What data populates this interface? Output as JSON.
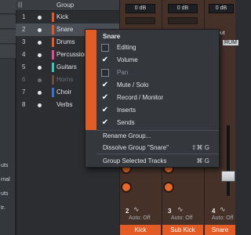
{
  "group_panel": {
    "header_label": "Group",
    "header_icon": "group-columns-icon"
  },
  "groups": [
    {
      "num": "1",
      "name": "Kick",
      "color": "#e0582a",
      "dim": false,
      "selected": false
    },
    {
      "num": "2",
      "name": "Snare",
      "color": "#e0582a",
      "dim": false,
      "selected": true
    },
    {
      "num": "3",
      "name": "Drums",
      "color": "#e0582a",
      "dim": false,
      "selected": false
    },
    {
      "num": "4",
      "name": "Percussion",
      "color": "#e24a93",
      "dim": false,
      "selected": false
    },
    {
      "num": "5",
      "name": "Guitars",
      "color": "#36c6c0",
      "dim": false,
      "selected": false
    },
    {
      "num": "6",
      "name": "Horns",
      "color": "#6b4a3e",
      "dim": true,
      "selected": false
    },
    {
      "num": "7",
      "name": "Choir",
      "color": "#3a6fd1",
      "dim": false,
      "selected": false
    },
    {
      "num": "8",
      "name": "Verbs",
      "color": "",
      "dim": false,
      "selected": false
    }
  ],
  "sidebar": {
    "items": [
      {
        "label": "uts"
      },
      {
        "label": "rnal"
      },
      {
        "label": "uts"
      },
      {
        "label": "tr."
      }
    ]
  },
  "mixer": {
    "db_values": [
      "0 dB",
      "0 dB",
      "0 dB"
    ],
    "input_label": "put",
    "rum_label": "RUM",
    "auto_labels": [
      "Auto: Off",
      "Auto: Off",
      "Auto: Off"
    ],
    "strip_numbers": [
      "2",
      "3",
      "4"
    ],
    "strip_names": [
      "Kick",
      "Sub Kick",
      "Snare"
    ]
  },
  "menu": {
    "title": "Snare",
    "options": [
      {
        "label": "Editing",
        "checked": false
      },
      {
        "label": "Volume",
        "checked": true
      },
      {
        "label": "Pan",
        "checked": false
      },
      {
        "label": "Mute / Solo",
        "checked": true
      },
      {
        "label": "Record / Monitor",
        "checked": true
      },
      {
        "label": "Inserts",
        "checked": true
      },
      {
        "label": "Sends",
        "checked": true
      }
    ],
    "actions": [
      {
        "label": "Rename Group...",
        "shortcut": ""
      },
      {
        "label": "Dissolve Group \"Snare\"",
        "shortcut": "⇧⌘ G"
      },
      {
        "label": "Group Selected Tracks",
        "shortcut": "⌘ G"
      }
    ],
    "check_glyph": "✔"
  }
}
